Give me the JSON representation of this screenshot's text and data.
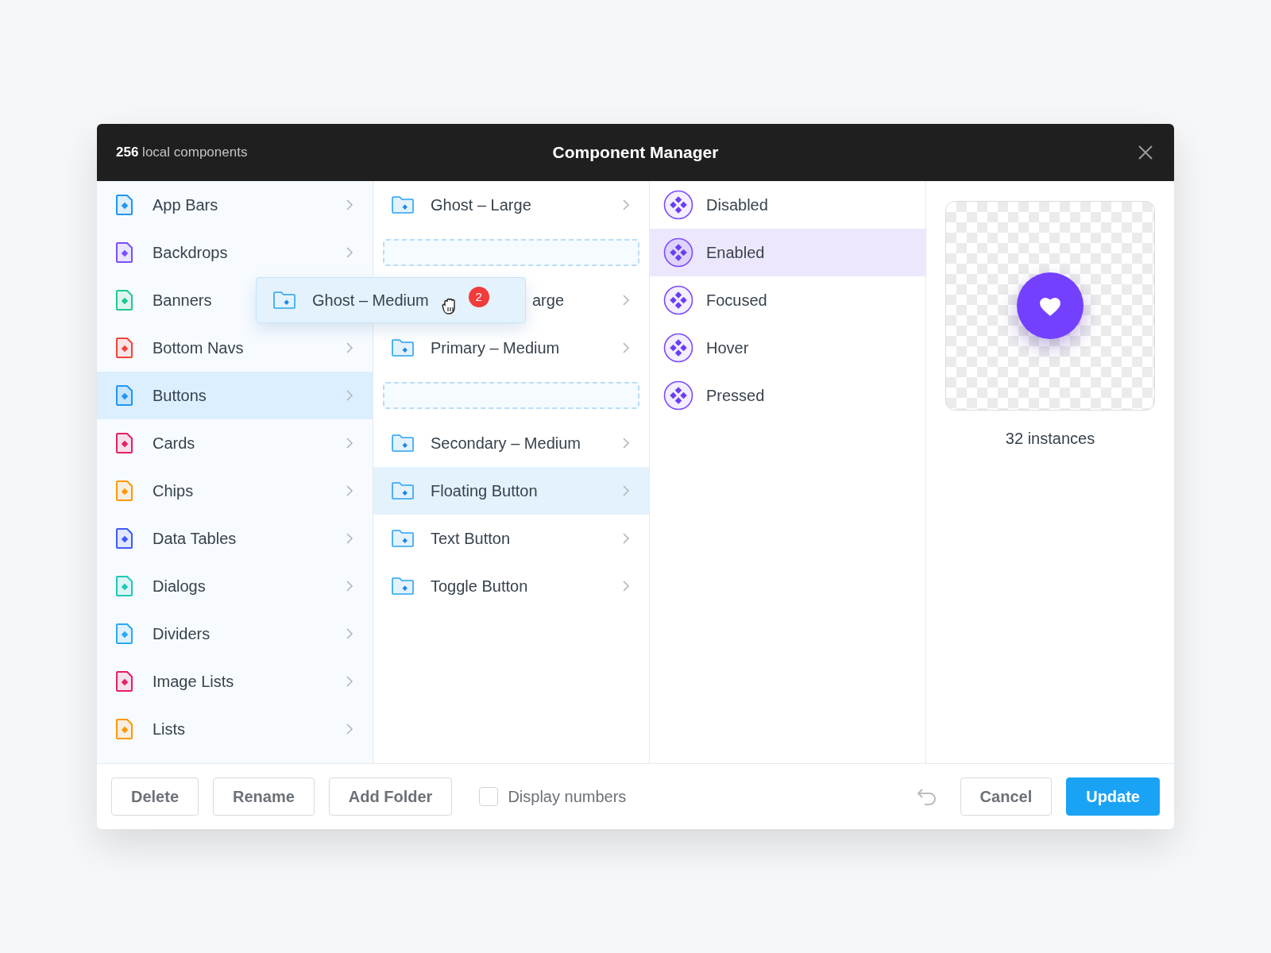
{
  "header": {
    "count": "256",
    "count_label": "local components",
    "title": "Component Manager"
  },
  "categories": [
    {
      "label": "App Bars",
      "color": "#2196f3",
      "selected": false,
      "chevron": true
    },
    {
      "label": "Backdrops",
      "color": "#7c4dff",
      "selected": false,
      "chevron": true
    },
    {
      "label": "Banners",
      "color": "#1fc98e",
      "selected": false,
      "chevron": false
    },
    {
      "label": "Bottom Navs",
      "color": "#f44336",
      "selected": false,
      "chevron": true
    },
    {
      "label": "Buttons",
      "color": "#2196f3",
      "selected": true,
      "chevron": true
    },
    {
      "label": "Cards",
      "color": "#e91e63",
      "selected": false,
      "chevron": true
    },
    {
      "label": "Chips",
      "color": "#ff9800",
      "selected": false,
      "chevron": true
    },
    {
      "label": "Data Tables",
      "color": "#3d5afe",
      "selected": false,
      "chevron": true
    },
    {
      "label": "Dialogs",
      "color": "#1dc9b7",
      "selected": false,
      "chevron": true
    },
    {
      "label": "Dividers",
      "color": "#29a9f6",
      "selected": false,
      "chevron": true
    },
    {
      "label": "Image Lists",
      "color": "#e91e63",
      "selected": false,
      "chevron": true
    },
    {
      "label": "Lists",
      "color": "#ff9800",
      "selected": false,
      "chevron": true
    }
  ],
  "folders": [
    {
      "kind": "folder",
      "label": "Ghost – Large",
      "selected": false
    },
    {
      "kind": "slot"
    },
    {
      "kind": "covered",
      "label": "arge",
      "selected": false
    },
    {
      "kind": "folder",
      "label": "Primary – Medium",
      "selected": false
    },
    {
      "kind": "slot"
    },
    {
      "kind": "folder",
      "label": "Secondary – Medium",
      "selected": false
    },
    {
      "kind": "folder",
      "label": "Floating Button",
      "selected": true
    },
    {
      "kind": "folder",
      "label": "Text Button",
      "selected": false
    },
    {
      "kind": "folder",
      "label": "Toggle Button",
      "selected": false
    }
  ],
  "dragged": {
    "label": "Ghost – Medium",
    "badge": "2"
  },
  "states": [
    {
      "label": "Disabled",
      "selected": false
    },
    {
      "label": "Enabled",
      "selected": true
    },
    {
      "label": "Focused",
      "selected": false
    },
    {
      "label": "Hover",
      "selected": false
    },
    {
      "label": "Pressed",
      "selected": false
    }
  ],
  "preview": {
    "instances": "32 instances"
  },
  "footer": {
    "buttons": [
      {
        "label": "Delete",
        "kind": "secondary"
      },
      {
        "label": "Rename",
        "kind": "secondary"
      },
      {
        "label": "Add Folder",
        "kind": "secondary"
      }
    ],
    "checkbox": {
      "label": "Display numbers",
      "checked": false
    },
    "actions": [
      {
        "label": "Cancel",
        "kind": "secondary"
      },
      {
        "label": "Update",
        "kind": "primary"
      }
    ]
  }
}
